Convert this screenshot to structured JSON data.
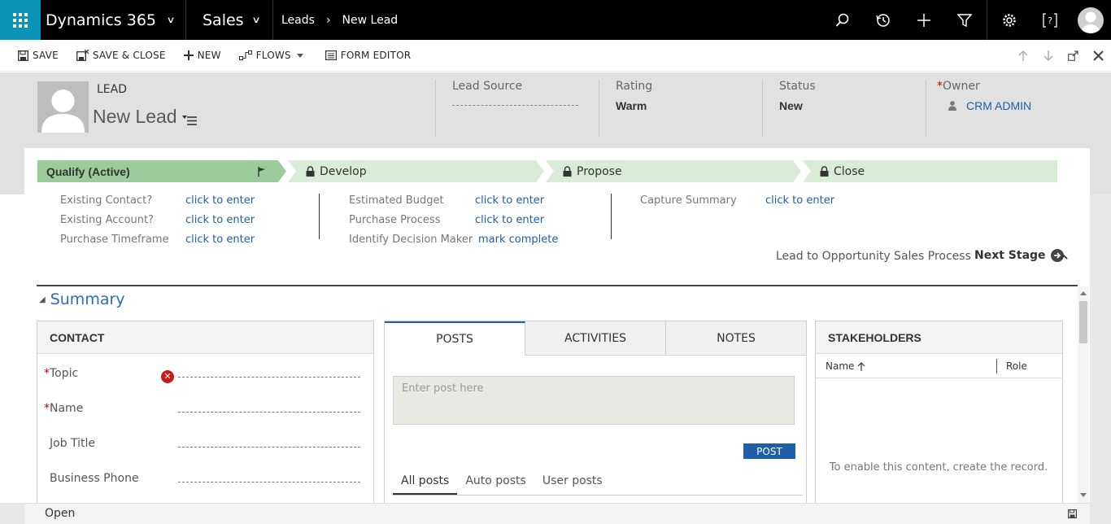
{
  "topnav": {
    "brand": "Dynamics 365",
    "app": "Sales",
    "breadcrumb": [
      "Leads",
      "New Lead"
    ]
  },
  "toolbar": {
    "save": "SAVE",
    "save_close": "SAVE & CLOSE",
    "new": "NEW",
    "flows": "FLOWS",
    "form_editor": "FORM EDITOR"
  },
  "header": {
    "entity_type": "LEAD",
    "entity_name": "New Lead",
    "fields": [
      {
        "label": "Lead Source",
        "value": ""
      },
      {
        "label": "Rating",
        "value": "Warm"
      },
      {
        "label": "Status",
        "value": "New"
      },
      {
        "label": "Owner",
        "value": "CRM ADMIN",
        "required": "*"
      }
    ]
  },
  "process": {
    "stages": [
      {
        "label": "Qualify (Active)",
        "active": true
      },
      {
        "label": "Develop",
        "active": false
      },
      {
        "label": "Propose",
        "active": false
      },
      {
        "label": "Close",
        "active": false
      }
    ],
    "steps_col1": [
      {
        "label": "Existing Contact?",
        "value": "click to enter"
      },
      {
        "label": "Existing Account?",
        "value": "click to enter"
      },
      {
        "label": "Purchase Timeframe",
        "value": "click to enter"
      }
    ],
    "steps_col2": [
      {
        "label": "Estimated Budget",
        "value": "click to enter"
      },
      {
        "label": "Purchase Process",
        "value": "click to enter"
      },
      {
        "label": "Identify Decision Maker",
        "value": "mark complete"
      }
    ],
    "steps_col3": [
      {
        "label": "Capture Summary",
        "value": "click to enter"
      }
    ],
    "process_name": "Lead to Opportunity Sales Process",
    "next_stage": "Next Stage"
  },
  "summary": {
    "title": "Summary",
    "contact": {
      "title": "CONTACT",
      "fields": [
        {
          "label": "Topic",
          "required": "*"
        },
        {
          "label": "Name",
          "required": "*"
        },
        {
          "label": "Job Title",
          "required": ""
        },
        {
          "label": "Business Phone",
          "required": ""
        }
      ]
    },
    "social": {
      "tabs": [
        "POSTS",
        "ACTIVITIES",
        "NOTES"
      ],
      "post_placeholder": "Enter post here",
      "post_button": "POST",
      "subtabs": [
        "All posts",
        "Auto posts",
        "User posts"
      ]
    },
    "stakeholders": {
      "title": "STAKEHOLDERS",
      "columns": [
        "Name",
        "Role"
      ],
      "empty_message": "To enable this content, create the record."
    }
  },
  "footer": {
    "status": "Open"
  },
  "colors": {
    "nav_bg": "#000000",
    "waffle_bg": "#0b94b5",
    "stage_active": "#9ccb9c",
    "stage_inactive": "#d8ecd8",
    "link": "#1e5fa8",
    "required": "#cc0000"
  }
}
